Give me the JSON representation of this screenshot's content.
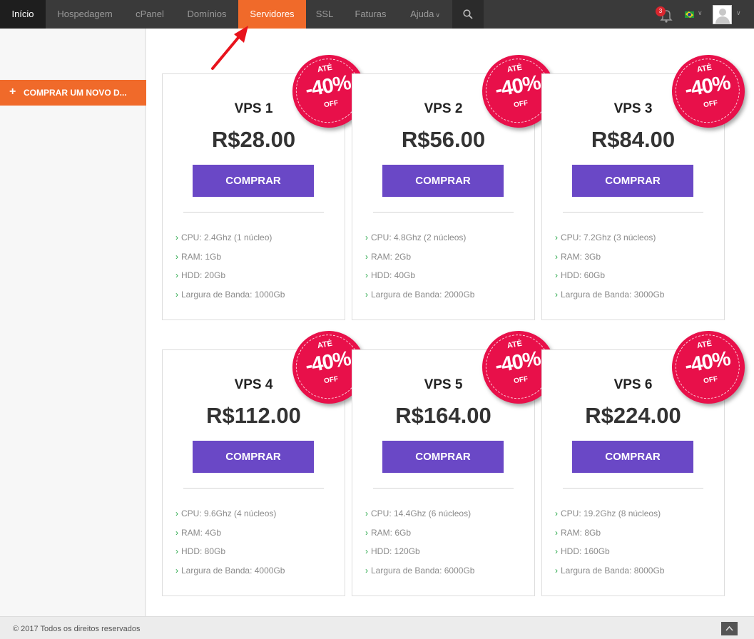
{
  "nav": {
    "items": [
      {
        "label": "Início"
      },
      {
        "label": "Hospedagem"
      },
      {
        "label": "cPanel"
      },
      {
        "label": "Domínios"
      },
      {
        "label": "Servidores"
      },
      {
        "label": "SSL"
      },
      {
        "label": "Faturas"
      },
      {
        "label": "Ajuda"
      }
    ],
    "active": "Servidores",
    "notification_count": "3",
    "accent_color": "#f06a2a"
  },
  "sidebar": {
    "buy_button_label": "COMPRAR UM NOVO D..."
  },
  "plans": [
    {
      "name": "VPS 1",
      "price": "R$28.00",
      "button": "COMPRAR",
      "badge_top": "ATÉ",
      "badge_discount": "-40%",
      "badge_bottom": "OFF",
      "specs": [
        "CPU: 2.4Ghz (1 núcleo)",
        "RAM: 1Gb",
        "HDD: 20Gb",
        "Largura de Banda: 1000Gb"
      ]
    },
    {
      "name": "VPS 2",
      "price": "R$56.00",
      "button": "COMPRAR",
      "badge_top": "ATÉ",
      "badge_discount": "-40%",
      "badge_bottom": "OFF",
      "specs": [
        "CPU: 4.8Ghz (2 núcleos)",
        "RAM: 2Gb",
        "HDD: 40Gb",
        "Largura de Banda: 2000Gb"
      ]
    },
    {
      "name": "VPS 3",
      "price": "R$84.00",
      "button": "COMPRAR",
      "badge_top": "ATÉ",
      "badge_discount": "-40%",
      "badge_bottom": "OFF",
      "specs": [
        "CPU: 7.2Ghz (3 núcleos)",
        "RAM: 3Gb",
        "HDD: 60Gb",
        "Largura de Banda: 3000Gb"
      ]
    },
    {
      "name": "VPS 4",
      "price": "R$112.00",
      "button": "COMPRAR",
      "badge_top": "ATÉ",
      "badge_discount": "-40%",
      "badge_bottom": "OFF",
      "specs": [
        "CPU: 9.6Ghz (4 núcleos)",
        "RAM: 4Gb",
        "HDD: 80Gb",
        "Largura de Banda: 4000Gb"
      ]
    },
    {
      "name": "VPS 5",
      "price": "R$164.00",
      "button": "COMPRAR",
      "badge_top": "ATÉ",
      "badge_discount": "-40%",
      "badge_bottom": "OFF",
      "specs": [
        "CPU: 14.4Ghz (6 núcleos)",
        "RAM: 6Gb",
        "HDD: 120Gb",
        "Largura de Banda: 6000Gb"
      ]
    },
    {
      "name": "VPS 6",
      "price": "R$224.00",
      "button": "COMPRAR",
      "badge_top": "ATÉ",
      "badge_discount": "-40%",
      "badge_bottom": "OFF",
      "specs": [
        "CPU: 19.2Ghz (8 núcleos)",
        "RAM: 8Gb",
        "HDD: 160Gb",
        "Largura de Banda: 8000Gb"
      ]
    }
  ],
  "colors": {
    "buy_button": "#6a48c6",
    "badge": "#e8104a",
    "spec_arrow": "#2aa84a"
  },
  "footer": {
    "copyright": "© 2017 Todos os direitos reservados"
  }
}
